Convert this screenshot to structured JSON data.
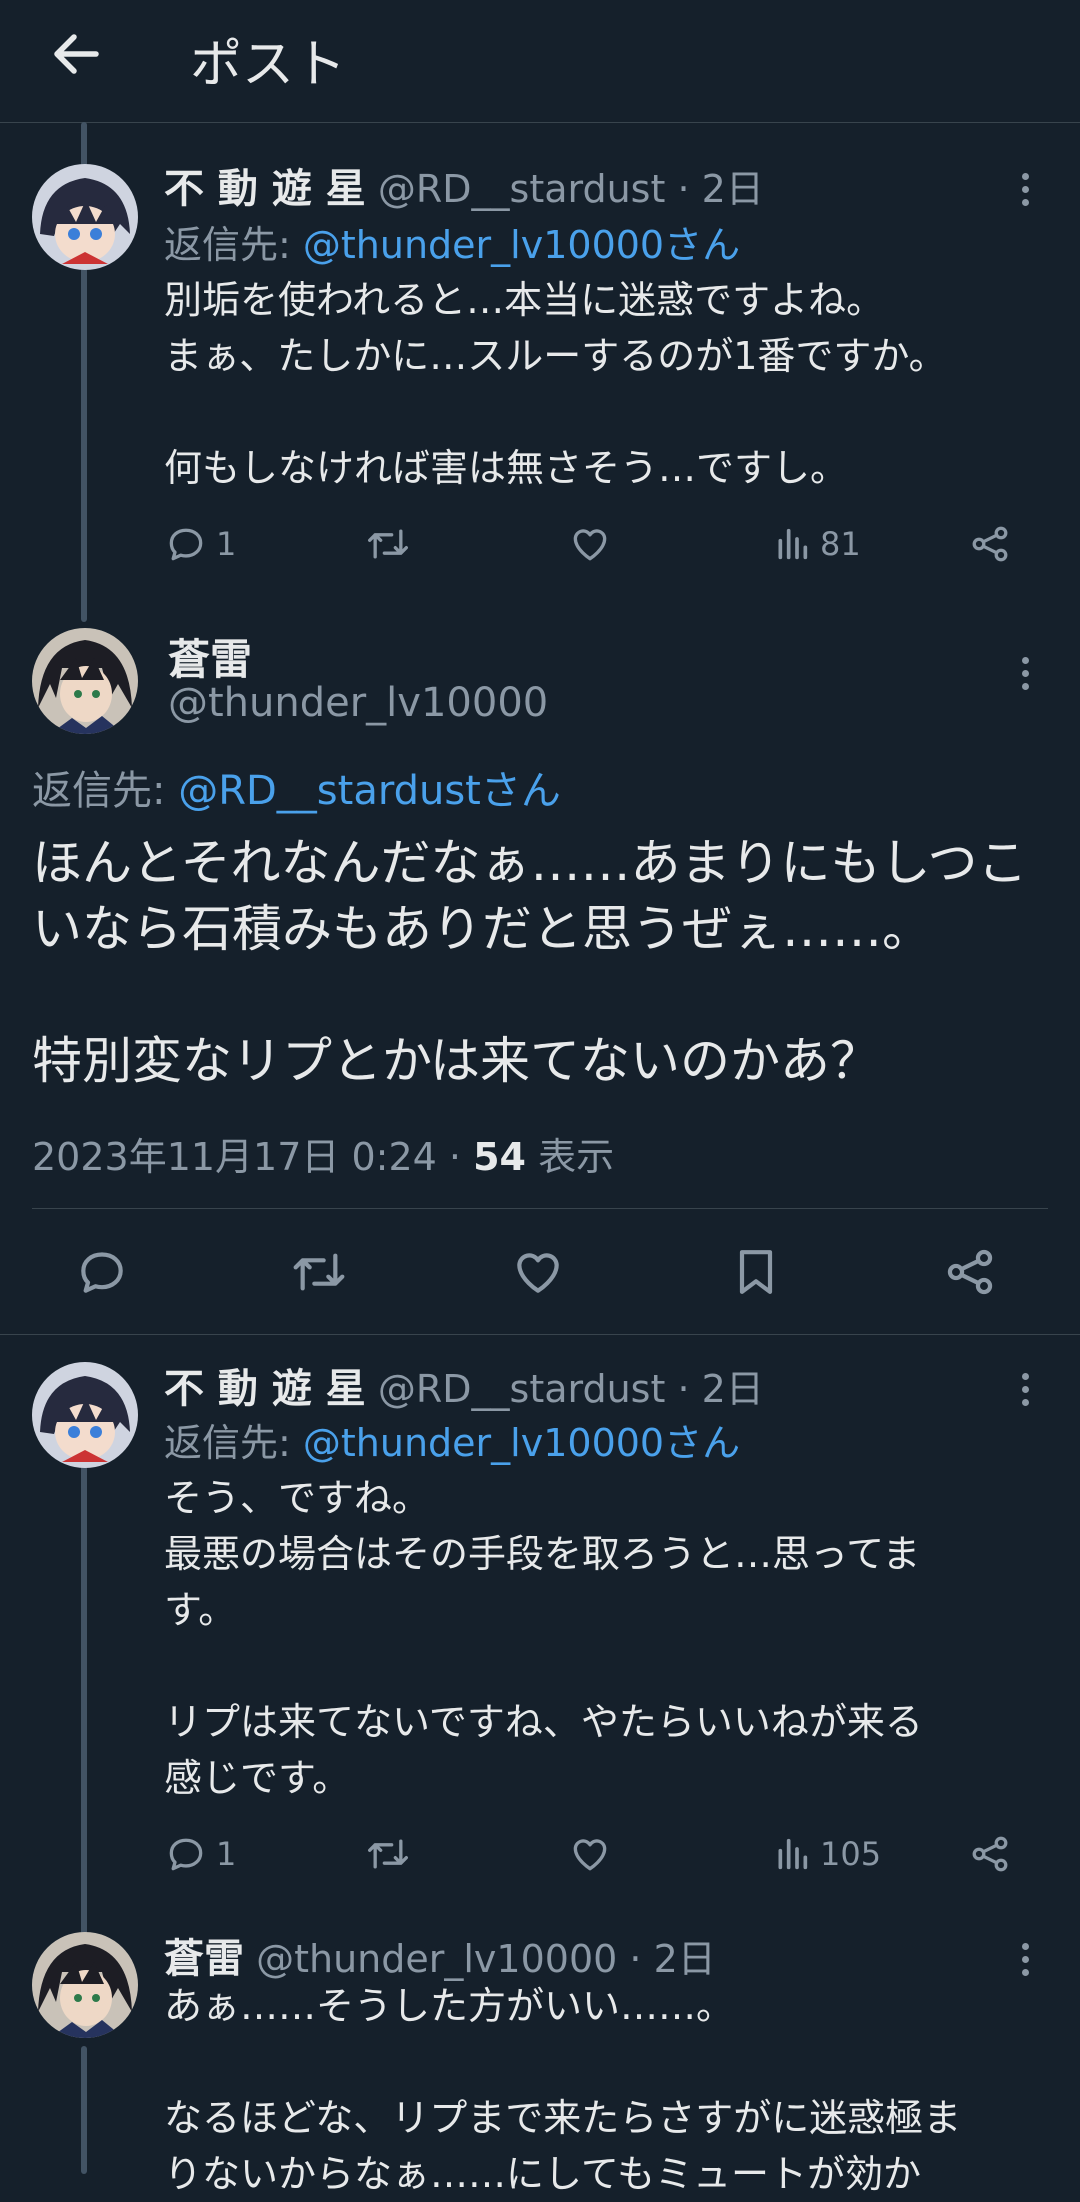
{
  "header": {
    "title": "ポスト"
  },
  "posts": [
    {
      "name": "不 動 遊 星",
      "handle": "@RD__stardust",
      "time": "· 2日",
      "reply_prefix": "返信先:",
      "reply_to": "@thunder_lv10000さん",
      "body": "別垢を使われると…本当に迷惑ですよね。\nまぁ、たしかに…スルーするのが1番ですか。\n\n何もしなければ害は無さそう…ですし。",
      "replies": "1",
      "views": "81"
    },
    {
      "name": "不 動 遊 星",
      "handle": "@RD__stardust",
      "time": "· 2日",
      "reply_prefix": "返信先:",
      "reply_to": "@thunder_lv10000さん",
      "body": "そう、ですね。\n最悪の場合はその手段を取ろうと…思ってま\nす。\n\nリプは来てないですね、やたらいいねが来る\n感じです。",
      "replies": "1",
      "views": "105"
    },
    {
      "name": "蒼雷",
      "handle": "@thunder_lv10000",
      "time": "· 2日",
      "body": "あぁ……そうした方がいい……。\n\nなるほどな、リプまで来たらさすがに迷惑極ま\nりないからなぁ……にしてもミュートが効か"
    }
  ],
  "main": {
    "name": "蒼雷",
    "handle": "@thunder_lv10000",
    "reply_prefix": "返信先:",
    "reply_to": "@RD__stardustさん",
    "body": "ほんとそれなんだなぁ……あまりにもしつこ\nいなら石積みもありだと思うぜぇ……。\n\n特別変なリプとかは来てないのかあ？",
    "date": "2023年11月17日 0:24 ·",
    "views_count": "54",
    "views_label": "表示"
  },
  "colors": {
    "background": "#15202b",
    "text": "#e7e9ea",
    "muted": "#8b98a5",
    "link": "#4aa1eb",
    "divider": "#38444d"
  }
}
